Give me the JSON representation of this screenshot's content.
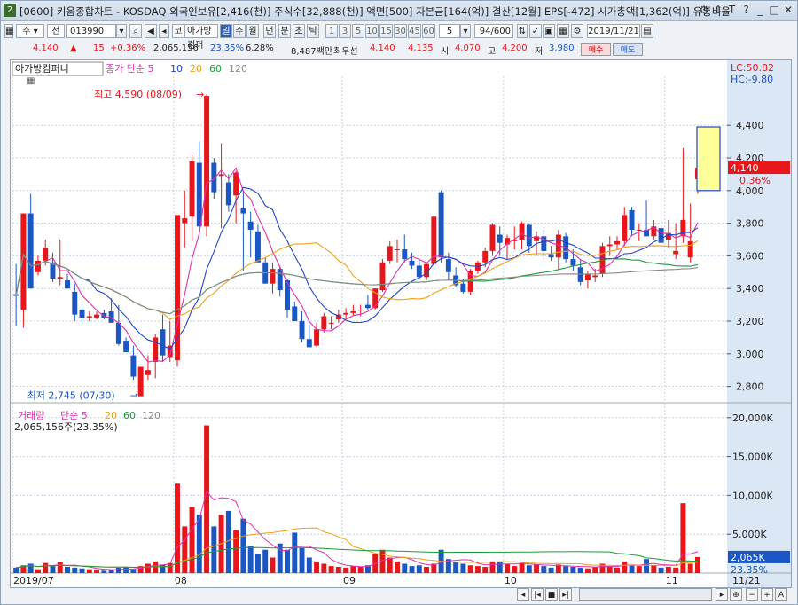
{
  "titlebar": {
    "num": "2",
    "title": "[0600] 키움종합차트 - KOSDAQ 외국인보유[2,416(천)] 주식수[32,888(천)] 액면[500] 자본금[164(억)] 결산[12월] EPS[-472] 시가총액[1,362(억)] 유통비율",
    "icons": [
      "gear-icon",
      "pin-icon",
      "text-icon",
      "help-icon",
      "minimize-icon",
      "maximize-icon",
      "close-icon"
    ]
  },
  "toolbar": {
    "market": "주",
    "mode": "전",
    "code": "013990",
    "name_prefix": "코",
    "name": "아가방컴퍼",
    "periods": [
      "일",
      "주",
      "월",
      "년",
      "분",
      "초",
      "틱"
    ],
    "active_period": "일",
    "intervals": [
      "1",
      "3",
      "5",
      "10",
      "15",
      "30",
      "45",
      "60"
    ],
    "interval_select": "5",
    "count": "94",
    "count_total": "/600",
    "date": "2019/11/21"
  },
  "quote": {
    "price": "4,140",
    "change": "15",
    "change_pct": "+0.36%",
    "volume": "2,065,156",
    "turnover_pct": "23.35%",
    "ratio": "6.28%",
    "amount": "8,487백만",
    "bid_label": "최우선",
    "bid1": "4,140",
    "bid2": "4,135",
    "open_label": "시",
    "open": "4,070",
    "high_label": "고",
    "high": "4,200",
    "low_label": "저",
    "low": "3,980",
    "buy_label": "매수",
    "sell_label": "매도"
  },
  "price_panel": {
    "name": "아가방컴퍼니",
    "legend_label": "종가 단순",
    "ma_periods": [
      "5",
      "10",
      "20",
      "60",
      "120"
    ],
    "max_annot": "최고 4,590 (08/09)",
    "min_annot": "최저 2,745 (07/30)",
    "lc": "LC:50.82",
    "hc": "HC:-9.80",
    "cur_price": "4,140",
    "cur_pct": "0.36%",
    "y_ticks": [
      "4,400",
      "4,200",
      "4,000",
      "3,800",
      "3,600",
      "3,400",
      "3,200",
      "3,000",
      "2,800"
    ]
  },
  "volume_panel": {
    "label": "거래량",
    "legend_label": "단순",
    "ma_periods": [
      "5",
      "20",
      "60",
      "120"
    ],
    "summary": "2,065,156주(23.35%)",
    "y_ticks": [
      "20,000K",
      "15,000K",
      "10,000K",
      "5,000K"
    ],
    "cur_vol": "2,065K",
    "cur_pct": "23.35%"
  },
  "x_axis": {
    "labels": [
      "2019/07",
      "08",
      "09",
      "10",
      "11"
    ],
    "last_date": "11/21"
  },
  "colors": {
    "up": "#e8161b",
    "down": "#1a56c4",
    "ma5": "#e030b0",
    "ma10": "#2244cc",
    "ma20": "#f0a010",
    "ma60": "#1a9a3a",
    "ma120": "#8a8a8a"
  },
  "chart_data": {
    "type": "candlestick",
    "ohlc": [
      [
        3365,
        3550,
        3170,
        3355
      ],
      [
        3270,
        3860,
        3160,
        3860
      ],
      [
        3860,
        3980,
        3400,
        3400
      ],
      [
        3500,
        3600,
        3480,
        3570
      ],
      [
        3570,
        3700,
        3540,
        3650
      ],
      [
        3560,
        3620,
        3440,
        3460
      ],
      [
        3460,
        3700,
        3420,
        3470
      ],
      [
        3450,
        3490,
        3400,
        3400
      ],
      [
        3380,
        3430,
        3200,
        3240
      ],
      [
        3270,
        3300,
        3180,
        3220
      ],
      [
        3220,
        3260,
        3200,
        3230
      ],
      [
        3220,
        3260,
        3210,
        3240
      ],
      [
        3250,
        3270,
        3210,
        3220
      ],
      [
        3260,
        3340,
        3200,
        3190
      ],
      [
        3190,
        3300,
        3050,
        3060
      ],
      [
        3080,
        3100,
        3010,
        3010
      ],
      [
        2990,
        3050,
        2840,
        2860
      ],
      [
        2740,
        2920,
        2740,
        2920
      ],
      [
        2870,
        2990,
        2840,
        2900
      ],
      [
        2950,
        3120,
        2850,
        3100
      ],
      [
        3150,
        3240,
        2950,
        2990
      ],
      [
        2980,
        3200,
        2950,
        3050
      ],
      [
        2960,
        3800,
        2920,
        3850
      ],
      [
        3800,
        4000,
        3650,
        3830
      ],
      [
        3840,
        4220,
        3690,
        4180
      ],
      [
        4170,
        4300,
        3990,
        3780
      ],
      [
        3780,
        4590,
        3720,
        4580
      ],
      [
        4170,
        4200,
        3950,
        3990
      ],
      [
        4090,
        4290,
        3770,
        4100
      ],
      [
        4050,
        4100,
        3870,
        3910
      ],
      [
        3970,
        4120,
        3800,
        4110
      ],
      [
        3890,
        4000,
        3510,
        3860
      ],
      [
        3810,
        3870,
        3590,
        3760
      ],
      [
        3750,
        3790,
        3560,
        3560
      ],
      [
        3560,
        3590,
        3430,
        3430
      ],
      [
        3430,
        3560,
        3370,
        3520
      ],
      [
        3520,
        3540,
        3350,
        3390
      ],
      [
        3450,
        3460,
        3220,
        3270
      ],
      [
        3290,
        3320,
        3200,
        3200
      ],
      [
        3200,
        3260,
        3070,
        3090
      ],
      [
        3090,
        3180,
        3040,
        3040
      ],
      [
        3050,
        3190,
        3040,
        3150
      ],
      [
        3150,
        3250,
        3130,
        3230
      ],
      [
        3190,
        3230,
        3150,
        3190
      ],
      [
        3210,
        3270,
        3190,
        3240
      ],
      [
        3240,
        3280,
        3210,
        3250
      ],
      [
        3250,
        3300,
        3230,
        3260
      ],
      [
        3270,
        3300,
        3230,
        3270
      ],
      [
        3300,
        3360,
        3270,
        3280
      ],
      [
        3280,
        3400,
        3270,
        3400
      ],
      [
        3390,
        3580,
        3380,
        3560
      ],
      [
        3570,
        3690,
        3550,
        3660
      ],
      [
        3640,
        3700,
        3560,
        3640
      ],
      [
        3640,
        3730,
        3560,
        3580
      ],
      [
        3570,
        3620,
        3520,
        3540
      ],
      [
        3540,
        3580,
        3460,
        3470
      ],
      [
        3470,
        3560,
        3450,
        3550
      ],
      [
        3550,
        3640,
        3540,
        3840
      ],
      [
        3990,
        4000,
        3560,
        3590
      ],
      [
        3580,
        3620,
        3450,
        3500
      ],
      [
        3480,
        3530,
        3410,
        3420
      ],
      [
        3430,
        3460,
        3370,
        3380
      ],
      [
        3380,
        3520,
        3360,
        3510
      ],
      [
        3510,
        3570,
        3490,
        3560
      ],
      [
        3560,
        3650,
        3530,
        3630
      ],
      [
        3630,
        3800,
        3600,
        3790
      ],
      [
        3730,
        3780,
        3600,
        3680
      ],
      [
        3670,
        3730,
        3580,
        3710
      ],
      [
        3690,
        3780,
        3640,
        3700
      ],
      [
        3700,
        3810,
        3640,
        3800
      ],
      [
        3790,
        3800,
        3620,
        3660
      ],
      [
        3690,
        3750,
        3600,
        3720
      ],
      [
        3720,
        3760,
        3580,
        3630
      ],
      [
        3610,
        3660,
        3570,
        3590
      ],
      [
        3590,
        3760,
        3520,
        3730
      ],
      [
        3720,
        3740,
        3560,
        3580
      ],
      [
        3580,
        3640,
        3510,
        3540
      ],
      [
        3530,
        3580,
        3420,
        3440
      ],
      [
        3450,
        3510,
        3400,
        3490
      ],
      [
        3470,
        3520,
        3440,
        3480
      ],
      [
        3490,
        3680,
        3470,
        3660
      ],
      [
        3660,
        3720,
        3600,
        3670
      ],
      [
        3670,
        3720,
        3640,
        3690
      ],
      [
        3690,
        3900,
        3660,
        3850
      ],
      [
        3880,
        3900,
        3720,
        3760
      ],
      [
        3760,
        3800,
        3690,
        3760
      ],
      [
        3760,
        3940,
        3720,
        3720
      ],
      [
        3720,
        3820,
        3700,
        3780
      ],
      [
        3770,
        3810,
        3680,
        3680
      ],
      [
        3700,
        3820,
        3650,
        3740
      ],
      [
        3610,
        3800,
        3580,
        3630
      ],
      [
        3720,
        4260,
        3680,
        3820
      ],
      [
        3590,
        3920,
        3560,
        3690
      ],
      [
        4070,
        4200,
        3980,
        4140
      ]
    ],
    "volume_k": [
      700,
      1000,
      1200,
      500,
      1300,
      900,
      1400,
      800,
      700,
      600,
      500,
      400,
      300,
      400,
      700,
      800,
      500,
      900,
      1200,
      1500,
      1100,
      1300,
      11500,
      6000,
      8500,
      7500,
      19000,
      6000,
      7500,
      8000,
      5500,
      7000,
      3500,
      2500,
      3000,
      2000,
      3800,
      3000,
      5200,
      3200,
      2000,
      1500,
      1200,
      900,
      800,
      700,
      900,
      800,
      1000,
      2500,
      3000,
      2000,
      1500,
      1200,
      900,
      1000,
      800,
      1200,
      3000,
      1800,
      1400,
      1200,
      1000,
      900,
      800,
      1500,
      1500,
      1200,
      900,
      1300,
      1000,
      1100,
      900,
      700,
      1100,
      900,
      800,
      700,
      600,
      800,
      1200,
      900,
      700,
      1500,
      1000,
      900,
      1800,
      1000,
      700,
      800,
      700,
      9000,
      1200,
      2065
    ],
    "x_labels": [
      "2019/07",
      "08",
      "09",
      "10",
      "11",
      "11/21"
    ],
    "y_range": [
      2700,
      4700
    ],
    "volume_range_k": [
      0,
      21000
    ]
  }
}
